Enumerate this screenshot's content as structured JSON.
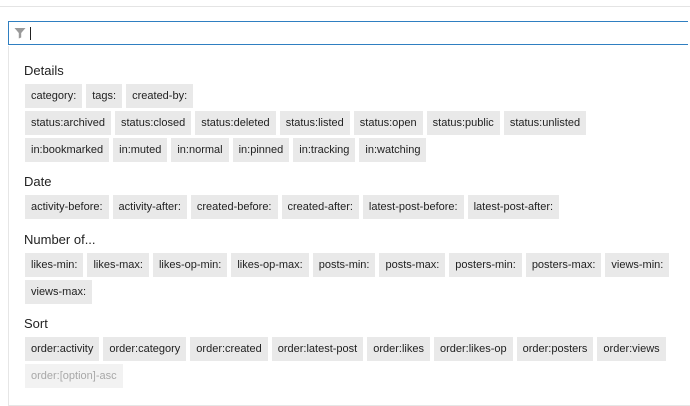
{
  "search": {
    "value": "",
    "placeholder": ""
  },
  "sections": {
    "details": {
      "title": "Details",
      "row1": [
        "category:",
        "tags:",
        "created-by:"
      ],
      "row2": [
        "status:archived",
        "status:closed",
        "status:deleted",
        "status:listed",
        "status:open",
        "status:public",
        "status:unlisted"
      ],
      "row3": [
        "in:bookmarked",
        "in:muted",
        "in:normal",
        "in:pinned",
        "in:tracking",
        "in:watching"
      ]
    },
    "date": {
      "title": "Date",
      "row1": [
        "activity-before:",
        "activity-after:",
        "created-before:",
        "created-after:",
        "latest-post-before:",
        "latest-post-after:"
      ]
    },
    "number_of": {
      "title": "Number of...",
      "row1": [
        "likes-min:",
        "likes-max:",
        "likes-op-min:",
        "likes-op-max:",
        "posts-min:",
        "posts-max:",
        "posters-min:",
        "posters-max:",
        "views-min:"
      ],
      "row2": [
        "views-max:"
      ]
    },
    "sort": {
      "title": "Sort",
      "row1": [
        "order:activity",
        "order:category",
        "order:created",
        "order:latest-post",
        "order:likes",
        "order:likes-op",
        "order:posters",
        "order:views"
      ],
      "row2": [
        "order:[option]-asc"
      ]
    }
  },
  "colors": {
    "focus_border": "#2f7fc1",
    "chip_bg": "#e9e9e9",
    "chip_dim_text": "#a8a8a8"
  }
}
